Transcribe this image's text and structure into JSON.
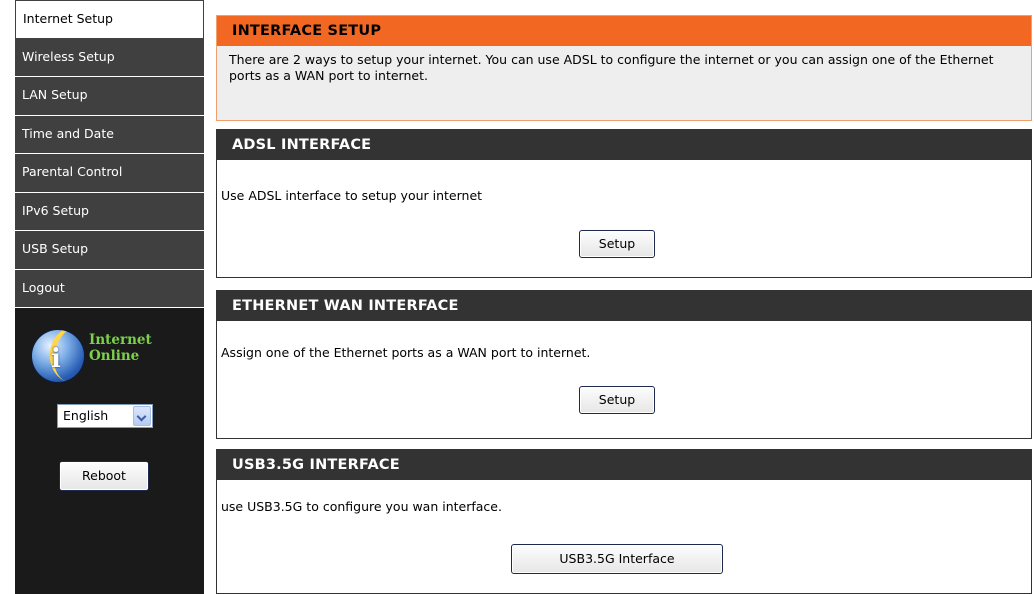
{
  "sidebar": {
    "items": [
      {
        "label": "Internet Setup",
        "active": true
      },
      {
        "label": "Wireless Setup",
        "active": false
      },
      {
        "label": "LAN Setup",
        "active": false
      },
      {
        "label": "Time and Date",
        "active": false
      },
      {
        "label": "Parental Control",
        "active": false
      },
      {
        "label": "IPv6 Setup",
        "active": false
      },
      {
        "label": "USB Setup",
        "active": false
      },
      {
        "label": "Logout",
        "active": false
      }
    ],
    "status": {
      "line1": "Internet",
      "line2": "Online",
      "icon": "internet-status-globe-icon"
    },
    "language": {
      "selected": "English"
    },
    "reboot_label": "Reboot"
  },
  "intro": {
    "title": "INTERFACE SETUP",
    "text": "There are 2 ways to setup your internet. You can use ADSL to configure the internet or you can assign one of the Ethernet ports as a WAN port to internet."
  },
  "adsl": {
    "title": "ADSL INTERFACE",
    "text": "Use ADSL interface to setup your internet",
    "button_label": "Setup"
  },
  "ethernet": {
    "title": "ETHERNET WAN INTERFACE",
    "text": "Assign one of the Ethernet ports as a WAN port to internet.",
    "button_label": "Setup"
  },
  "usb": {
    "title": "USB3.5G INTERFACE",
    "text": "use USB3.5G to configure you wan interface.",
    "button_label": "USB3.5G Interface"
  },
  "colors": {
    "accent_orange": "#f26822",
    "header_dark": "#333333",
    "sidebar_bg": "#1a1a1a",
    "status_green": "#7bd24a"
  }
}
